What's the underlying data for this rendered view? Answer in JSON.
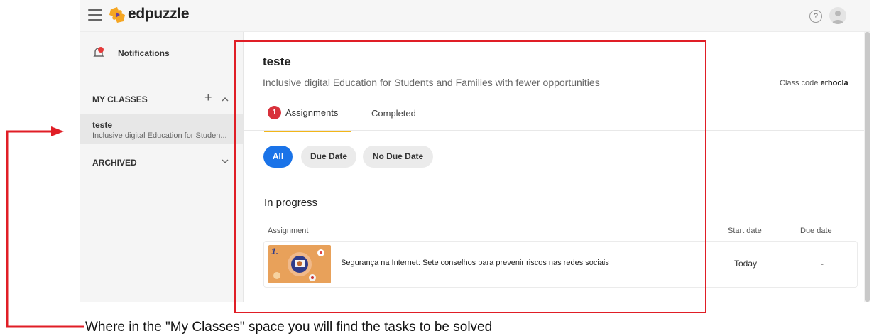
{
  "topbar": {
    "logo_text": "edpuzzle",
    "help_icon": "?",
    "icons": [
      "hamburger-menu-icon",
      "edpuzzle-logo-icon",
      "help-icon",
      "user-avatar-icon"
    ]
  },
  "sidebar": {
    "notifications_label": "Notifications",
    "my_classes_label": "MY CLASSES",
    "add_label": "+",
    "classes": [
      {
        "name": "teste",
        "description": "Inclusive digital Education for Studen..."
      }
    ],
    "archived_label": "ARCHIVED"
  },
  "main": {
    "class_title": "teste",
    "class_subtitle": "Inclusive digital Education for Students and Families with fewer opportunities",
    "class_code_label": "Class code",
    "class_code_value": "erhocla",
    "tabs": [
      {
        "label": "Assignments",
        "badge": "1",
        "active": true
      },
      {
        "label": "Completed",
        "active": false
      }
    ],
    "filters": [
      {
        "label": "All",
        "active": true
      },
      {
        "label": "Due Date",
        "active": false
      },
      {
        "label": "No Due Date",
        "active": false
      }
    ],
    "section_title": "In progress",
    "columns": {
      "assignment": "Assignment",
      "start_date": "Start date",
      "due_date": "Due date"
    },
    "assignments": [
      {
        "title": "Segurança na Internet: Sete conselhos para prevenir riscos nas redes sociais",
        "thumb_number": "1.",
        "start_date": "Today",
        "due_date": "-"
      }
    ]
  },
  "annotation": {
    "caption": "Where in the \"My Classes\" space you will find the tasks to be solved"
  },
  "colors": {
    "accent_blue": "#1a73e8",
    "tab_underline": "#f2b619",
    "badge_red": "#d8313b",
    "annotation_red": "#e01e26",
    "thumb_orange": "#e8a15a"
  }
}
